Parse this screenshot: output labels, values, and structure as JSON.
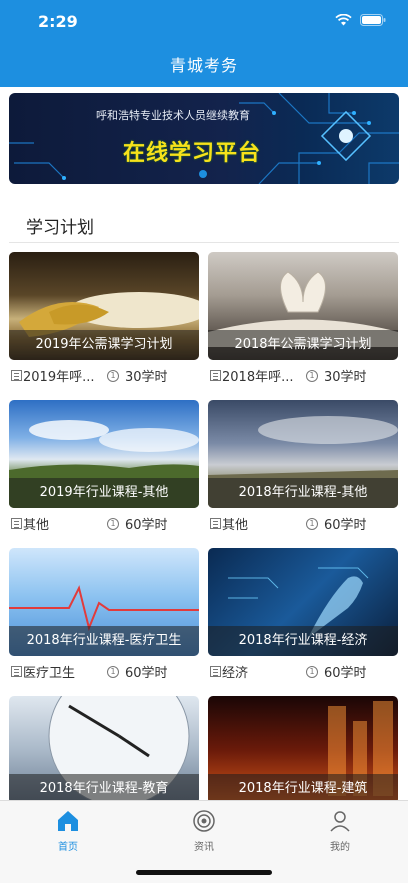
{
  "status_bar": {
    "time": "2:29"
  },
  "nav": {
    "title": "青城考务"
  },
  "banner": {
    "subtitle": "呼和浩特专业技术人员继续教育",
    "headline": "在线学习平台"
  },
  "section": {
    "title": "学习计划"
  },
  "cards": [
    {
      "title": "2019年公需课学习计划",
      "category": "2019年呼...",
      "hours": "30学时"
    },
    {
      "title": "2018年公需课学习计划",
      "category": "2018年呼...",
      "hours": "30学时"
    },
    {
      "title": "2019年行业课程-其他",
      "category": "其他",
      "hours": "60学时"
    },
    {
      "title": "2018年行业课程-其他",
      "category": "其他",
      "hours": "60学时"
    },
    {
      "title": "2018年行业课程-医疗卫生",
      "category": "医疗卫生",
      "hours": "60学时"
    },
    {
      "title": "2018年行业课程-经济",
      "category": "经济",
      "hours": "60学时"
    },
    {
      "title": "2018年行业课程-教育",
      "category": "",
      "hours": ""
    },
    {
      "title": "2018年行业课程-建筑",
      "category": "",
      "hours": ""
    }
  ],
  "tabbar": {
    "items": [
      {
        "label": "首页",
        "icon": "home-icon",
        "active": true
      },
      {
        "label": "资讯",
        "icon": "news-icon",
        "active": false
      },
      {
        "label": "我的",
        "icon": "profile-icon",
        "active": false
      }
    ]
  },
  "colors": {
    "accent": "#1d8fe0",
    "banner_text": "#f7e21b"
  }
}
